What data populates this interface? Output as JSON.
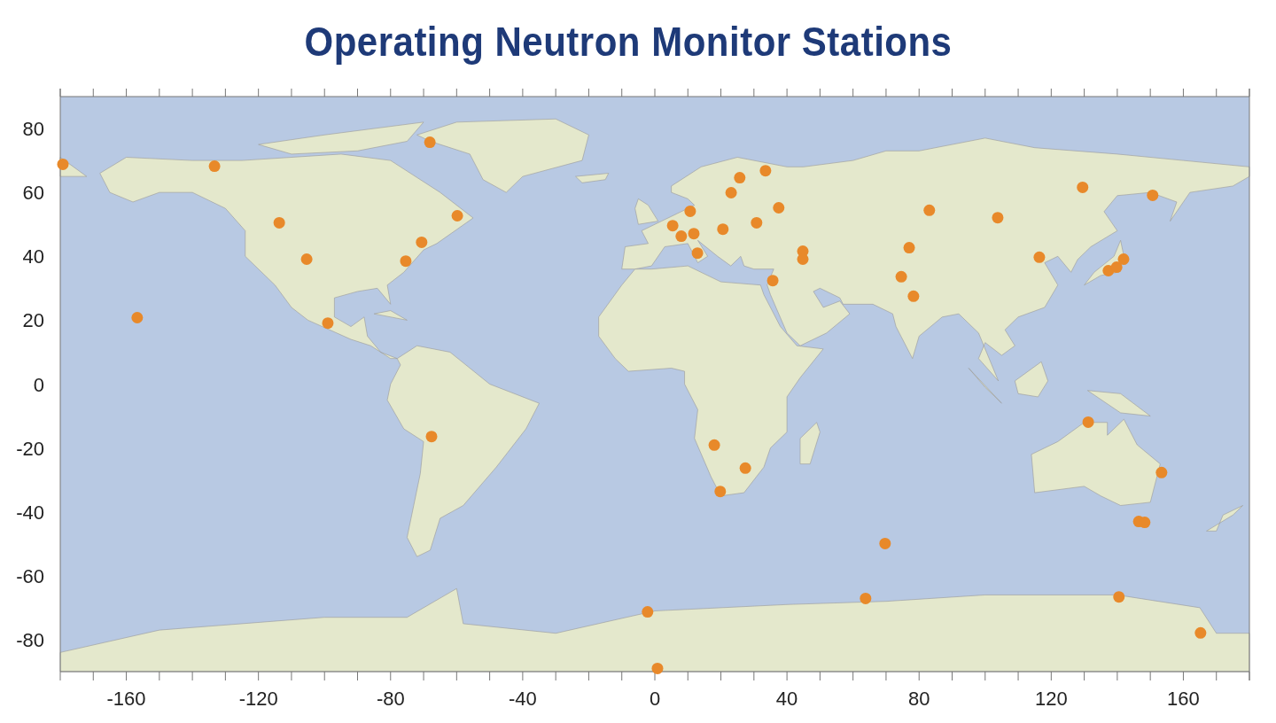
{
  "title": "Operating Neutron Monitor Stations",
  "chart_data": {
    "type": "scatter",
    "xlim": [
      -180,
      180
    ],
    "ylim": [
      -90,
      90
    ],
    "xticks": [
      -160,
      -120,
      -80,
      -40,
      0,
      40,
      80,
      120,
      160
    ],
    "yticks": [
      -80,
      -60,
      -40,
      -20,
      0,
      20,
      40,
      60,
      80
    ],
    "x": [
      -179.2,
      -133.3,
      -156.7,
      -113.7,
      -105.4,
      -99,
      -68.1,
      -59.8,
      -70.6,
      -75.4,
      -67.6,
      -2.2,
      0.8,
      5.4,
      8.0,
      10.7,
      11.8,
      12.9,
      20.6,
      23.1,
      25.7,
      33.5,
      30.8,
      37.5,
      35.7,
      44.8,
      44.8,
      18,
      27.4,
      19.8,
      63.8,
      69.7,
      77,
      74.6,
      78.3,
      83.1,
      103.8,
      116.4,
      129.5,
      150.7,
      137.3,
      139.8,
      141.9,
      131.2,
      153.4,
      146.5,
      148.3,
      140.5,
      165.2
    ],
    "series": [
      {
        "color": "#e8892a",
        "values": [
          68.8,
          68.2,
          20.8,
          50.5,
          39.1,
          19.1,
          75.7,
          52.7,
          44.4,
          38.5,
          -16.4,
          -71.3,
          -89,
          49.6,
          46.3,
          54.1,
          47.1,
          41.0,
          48.5,
          59.9,
          64.6,
          66.8,
          50.5,
          55.2,
          32.4,
          41.6,
          39.1,
          -19.1,
          -26.3,
          -33.6,
          -67.1,
          -49.9,
          42.7,
          33.6,
          27.5,
          54.4,
          52.1,
          39.7,
          61.6,
          59.1,
          35.5,
          36.6,
          39.1,
          -11.9,
          -27.7,
          -43.0,
          -43.3,
          -66.6,
          -77.9
        ]
      }
    ]
  }
}
